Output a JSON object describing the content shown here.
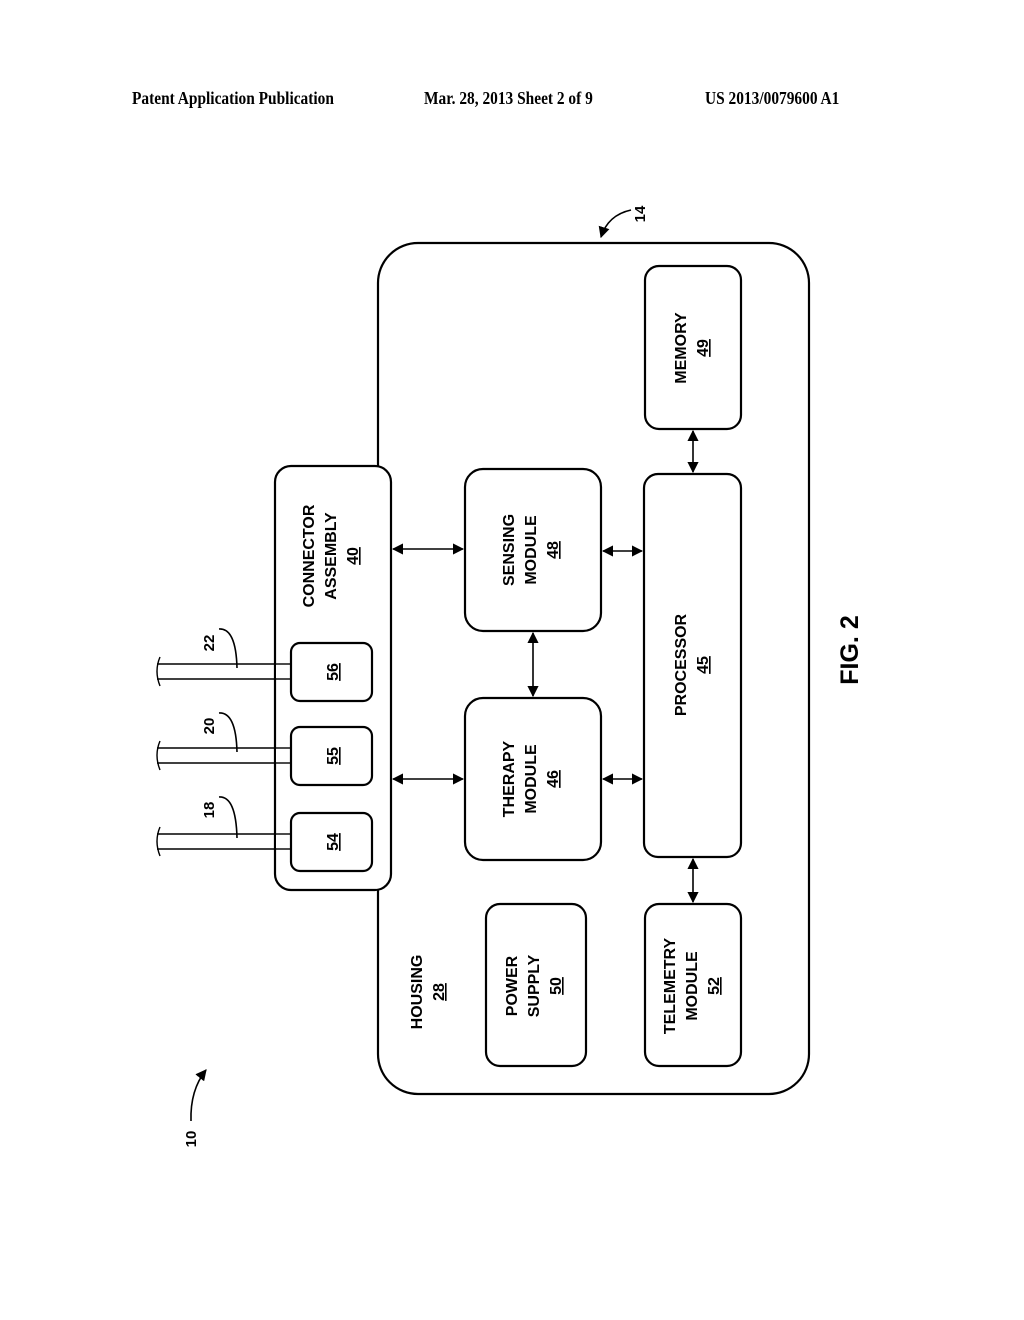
{
  "header": {
    "publication": "Patent Application Publication",
    "date_sheet": "Mar. 28, 2013  Sheet 2 of 9",
    "number": "US 2013/0079600 A1"
  },
  "figure": {
    "label": "FIG. 2",
    "system_ref": "10",
    "device_ref": "14"
  },
  "housing": {
    "name": "HOUSING",
    "ref": "28"
  },
  "connector": {
    "line1": "CONNECTOR",
    "line2": "ASSEMBLY",
    "ref": "40"
  },
  "ports": [
    {
      "ref": "56",
      "lead": "22"
    },
    {
      "ref": "55",
      "lead": "20"
    },
    {
      "ref": "54",
      "lead": "18"
    }
  ],
  "modules": {
    "sensing": {
      "line1": "SENSING",
      "line2": "MODULE",
      "ref": "48"
    },
    "therapy": {
      "line1": "THERAPY",
      "line2": "MODULE",
      "ref": "46"
    },
    "processor": {
      "line1": "PROCESSOR",
      "ref": "45"
    },
    "memory": {
      "line1": "MEMORY",
      "ref": "49"
    },
    "telemetry": {
      "line1": "TELEMETRY",
      "line2": "MODULE",
      "ref": "52"
    },
    "power": {
      "line1": "POWER",
      "line2": "SUPPLY",
      "ref": "50"
    }
  }
}
